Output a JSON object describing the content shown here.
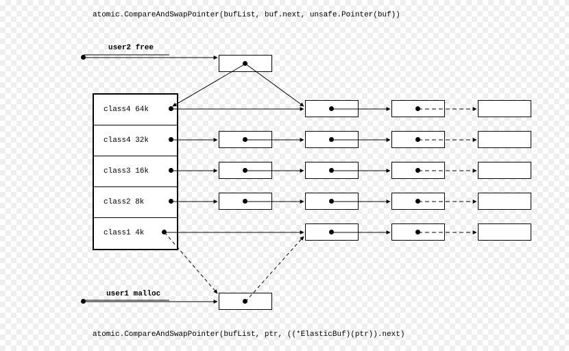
{
  "top_code": "atomic.CompareAndSwapPointer(bufList, buf.next, unsafe.Pointer(buf))",
  "bottom_code": "atomic.CompareAndSwapPointer(bufList, ptr, ((*ElasticBuf)(ptr)).next)",
  "user_free_label": "user2 free",
  "user_malloc_label": "user1 malloc",
  "classes": [
    {
      "label": "class4 64k"
    },
    {
      "label": "class4 32k"
    },
    {
      "label": "class3 16k"
    },
    {
      "label": "class2 8k"
    },
    {
      "label": "class1 4k"
    }
  ]
}
